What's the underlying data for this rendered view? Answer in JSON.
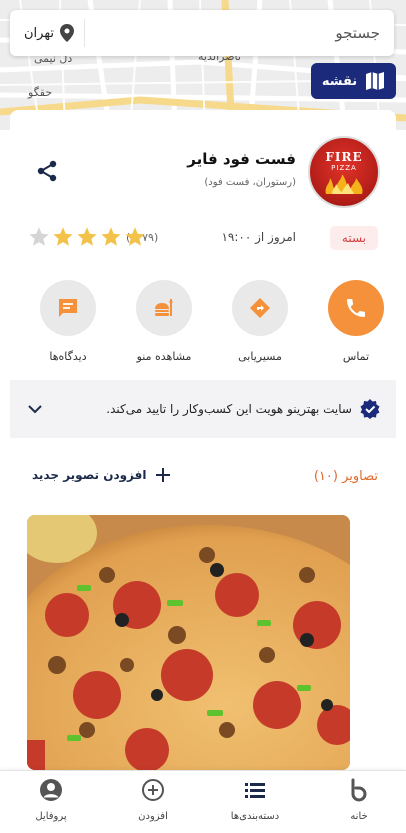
{
  "search": {
    "placeholder": "جستجو"
  },
  "city": {
    "name": "تهران"
  },
  "map_button": {
    "label": "نقشه"
  },
  "map_labels": [
    "دل نیمی",
    "حقگو",
    "ناصرالدیه"
  ],
  "business": {
    "logo_text_top": "FIRE",
    "logo_text_bottom": "PIZZA",
    "name": "فست فود فایر",
    "categories": "(رستوران، فست فود)",
    "status": "بسته",
    "opens": "امروز از ۱۹:۰۰",
    "rating_count": "(۱۰۷۹)",
    "rating": 4
  },
  "actions": [
    {
      "label": "تماس",
      "icon": "phone-icon"
    },
    {
      "label": "مسیریابی",
      "icon": "directions-icon"
    },
    {
      "label": "مشاهده منو",
      "icon": "menu-icon"
    },
    {
      "label": "دیدگاه‌ها",
      "icon": "comment-icon"
    }
  ],
  "verification": {
    "text": "سایت بهترینو هویت این کسب‌وکار را تایید می‌کند."
  },
  "photos": {
    "title": "تصاویر (۱۰)",
    "add_label": "افزودن تصویر جدید"
  },
  "nav": [
    {
      "label": "خانه",
      "icon": "home-icon"
    },
    {
      "label": "دسته‌بندی‌ها",
      "icon": "list-icon"
    },
    {
      "label": "افزودن",
      "icon": "add-circle-icon"
    },
    {
      "label": "پروفایل",
      "icon": "profile-icon"
    }
  ],
  "colors": {
    "primary_navy": "#1b2a7a",
    "accent_orange": "#f4913a",
    "closed_red": "#d43f3f",
    "star_gold": "#f2c24a"
  }
}
